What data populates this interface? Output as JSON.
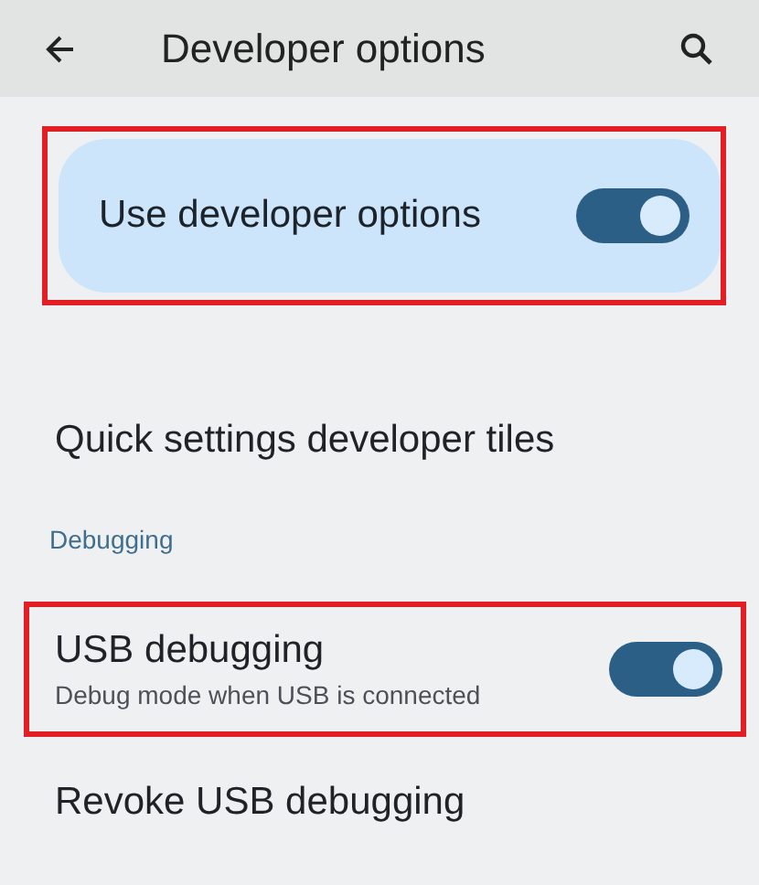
{
  "app_bar": {
    "title": "Developer options"
  },
  "main_switch": {
    "label": "Use developer options",
    "on": true,
    "highlighted": true
  },
  "items": [
    {
      "kind": "item",
      "title": "Quick settings developer tiles",
      "highlighted": false
    },
    {
      "kind": "header",
      "title": "Debugging"
    },
    {
      "kind": "switch",
      "title": "USB debugging",
      "summary": "Debug mode when USB is connected",
      "on": true,
      "highlighted": true
    },
    {
      "kind": "item",
      "title": "Revoke USB debugging",
      "highlighted": false
    }
  ]
}
